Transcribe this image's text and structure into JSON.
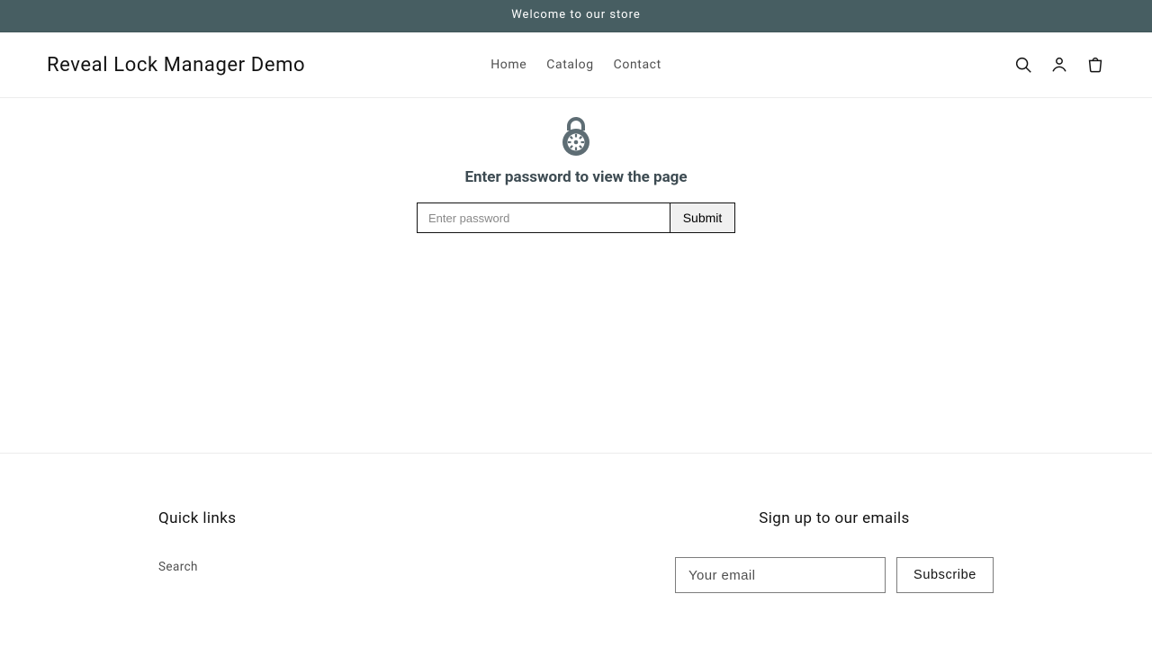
{
  "announcement": "Welcome to our store",
  "brand": "Reveal Lock Manager Demo",
  "nav": {
    "home": "Home",
    "catalog": "Catalog",
    "contact": "Contact"
  },
  "main": {
    "prompt": "Enter password to view the page",
    "placeholder": "Enter password",
    "submit": "Submit"
  },
  "footer": {
    "links_heading": "Quick links",
    "search_link": "Search",
    "signup_heading": "Sign up to our emails",
    "email_placeholder": "Your email",
    "subscribe": "Subscribe"
  }
}
